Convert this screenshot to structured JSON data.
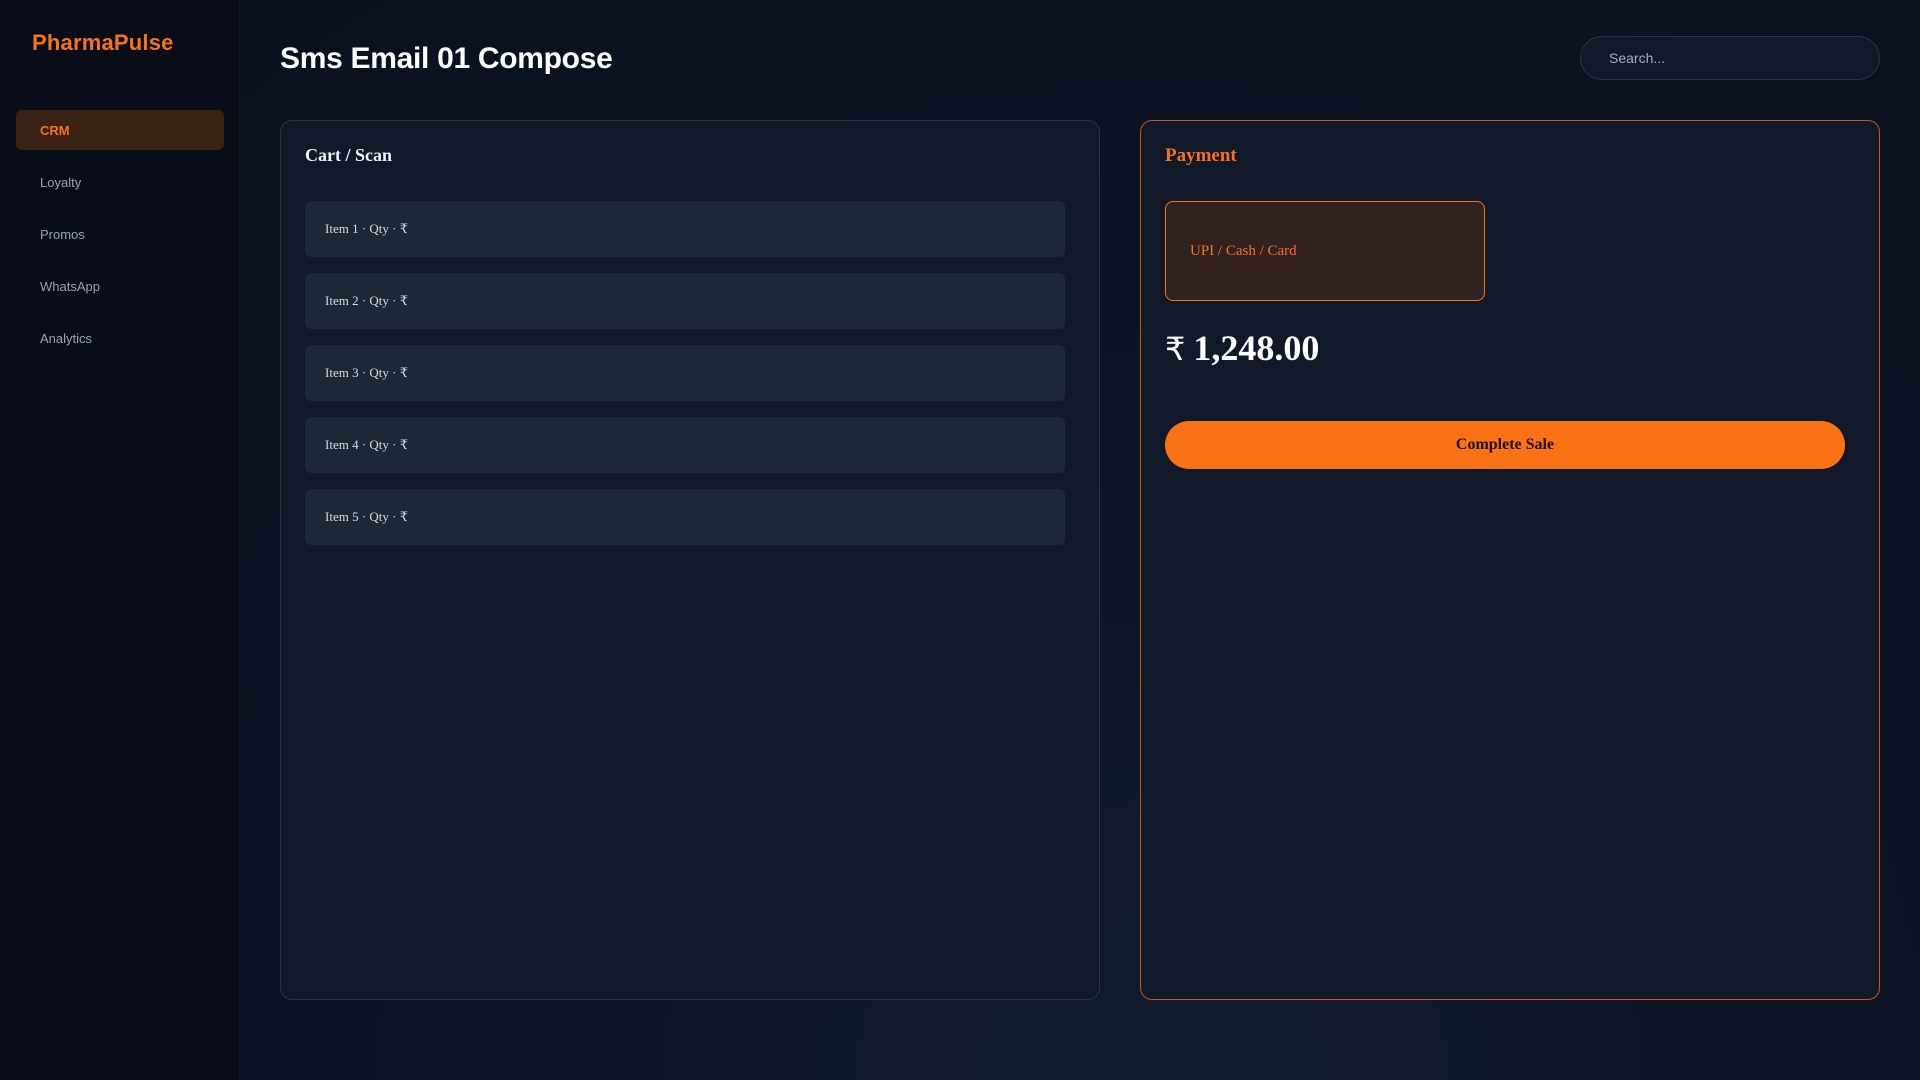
{
  "sidebar": {
    "brand": "PharmaPulse",
    "items": [
      {
        "label": "CRM",
        "active": true
      },
      {
        "label": "Loyalty",
        "active": false
      },
      {
        "label": "Promos",
        "active": false
      },
      {
        "label": "WhatsApp",
        "active": false
      },
      {
        "label": "Analytics",
        "active": false
      }
    ]
  },
  "header": {
    "title": "Sms Email 01 Compose",
    "search_placeholder": "Search..."
  },
  "cart": {
    "title": "Cart / Scan",
    "items": [
      "Item 1 · Qty · ₹",
      "Item 2 · Qty · ₹",
      "Item 3 · Qty · ₹",
      "Item 4 · Qty · ₹",
      "Item 5 · Qty · ₹"
    ]
  },
  "payment": {
    "title": "Payment",
    "method_label": "UPI / Cash / Card",
    "currency_symbol": "₹",
    "total": "1,248.00",
    "complete_label": "Complete Sale"
  },
  "colors": {
    "accent": "#f97316",
    "background": "#0b1220",
    "panel": "#111827"
  }
}
